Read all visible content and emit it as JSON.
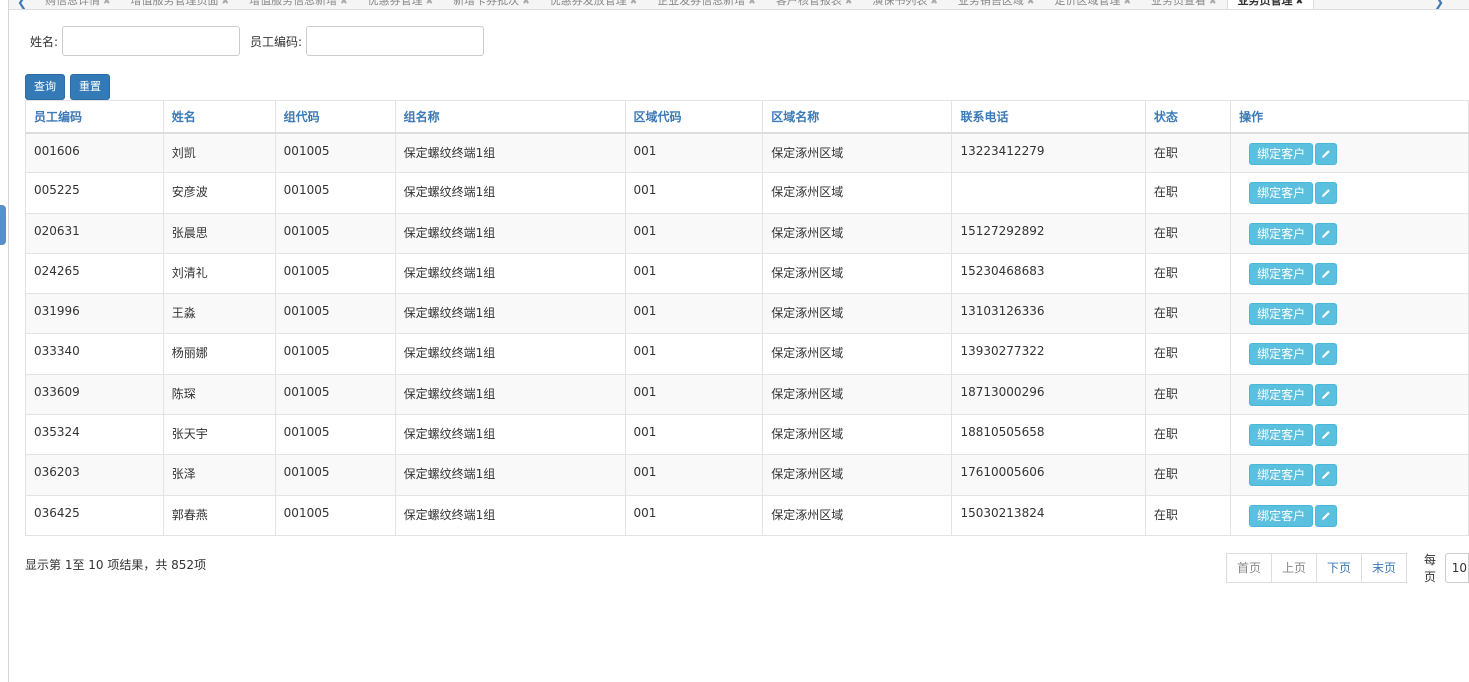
{
  "tabs": [
    {
      "label": "购信息详情"
    },
    {
      "label": "增值服务管理页面"
    },
    {
      "label": "增值服务信息新增"
    },
    {
      "label": "优惠券管理"
    },
    {
      "label": "新增卡券批次"
    },
    {
      "label": "优惠券发放管理"
    },
    {
      "label": "企业发券信息新增"
    },
    {
      "label": "客户核管报表"
    },
    {
      "label": "演保书列表"
    },
    {
      "label": "业务销售区域"
    },
    {
      "label": "定价区域管理"
    },
    {
      "label": "业务员查看"
    },
    {
      "label": "业务员管理",
      "active": true
    }
  ],
  "filters": {
    "name_label": "姓名:",
    "name_value": "",
    "code_label": "员工编码:",
    "code_value": ""
  },
  "buttons": {
    "query": "查询",
    "reset": "重置"
  },
  "table": {
    "columns": [
      "员工编码",
      "姓名",
      "组代码",
      "组名称",
      "区域代码",
      "区域名称",
      "联系电话",
      "状态",
      "操作"
    ],
    "rows": [
      [
        "001606",
        "刘凯",
        "001005",
        "保定螺纹终端1组",
        "001",
        "保定涿州区域",
        "13223412279",
        "在职"
      ],
      [
        "005225",
        "安彦波",
        "001005",
        "保定螺纹终端1组",
        "001",
        "保定涿州区域",
        "",
        "在职"
      ],
      [
        "020631",
        "张晨思",
        "001005",
        "保定螺纹终端1组",
        "001",
        "保定涿州区域",
        "15127292892",
        "在职"
      ],
      [
        "024265",
        "刘清礼",
        "001005",
        "保定螺纹终端1组",
        "001",
        "保定涿州区域",
        "15230468683",
        "在职"
      ],
      [
        "031996",
        "王淼",
        "001005",
        "保定螺纹终端1组",
        "001",
        "保定涿州区域",
        "13103126336",
        "在职"
      ],
      [
        "033340",
        "杨丽娜",
        "001005",
        "保定螺纹终端1组",
        "001",
        "保定涿州区域",
        "13930277322",
        "在职"
      ],
      [
        "033609",
        "陈琛",
        "001005",
        "保定螺纹终端1组",
        "001",
        "保定涿州区域",
        "18713000296",
        "在职"
      ],
      [
        "035324",
        "张天宇",
        "001005",
        "保定螺纹终端1组",
        "001",
        "保定涿州区域",
        "18810505658",
        "在职"
      ],
      [
        "036203",
        "张泽",
        "001005",
        "保定螺纹终端1组",
        "001",
        "保定涿州区域",
        "17610005606",
        "在职"
      ],
      [
        "036425",
        "郭春燕",
        "001005",
        "保定螺纹终端1组",
        "001",
        "保定涿州区域",
        "15030213824",
        "在职"
      ]
    ],
    "bind_label": "绑定客户"
  },
  "summary": "显示第 1至 10 项结果，共 852项",
  "pager": {
    "first": "首页",
    "prev": "上页",
    "next": "下页",
    "last": "末页"
  },
  "per_page": {
    "label": "每页",
    "value": "10"
  },
  "colors": {
    "primary": "#337ab7",
    "info": "#5bc0de",
    "header_text": "#3c7ab8"
  }
}
